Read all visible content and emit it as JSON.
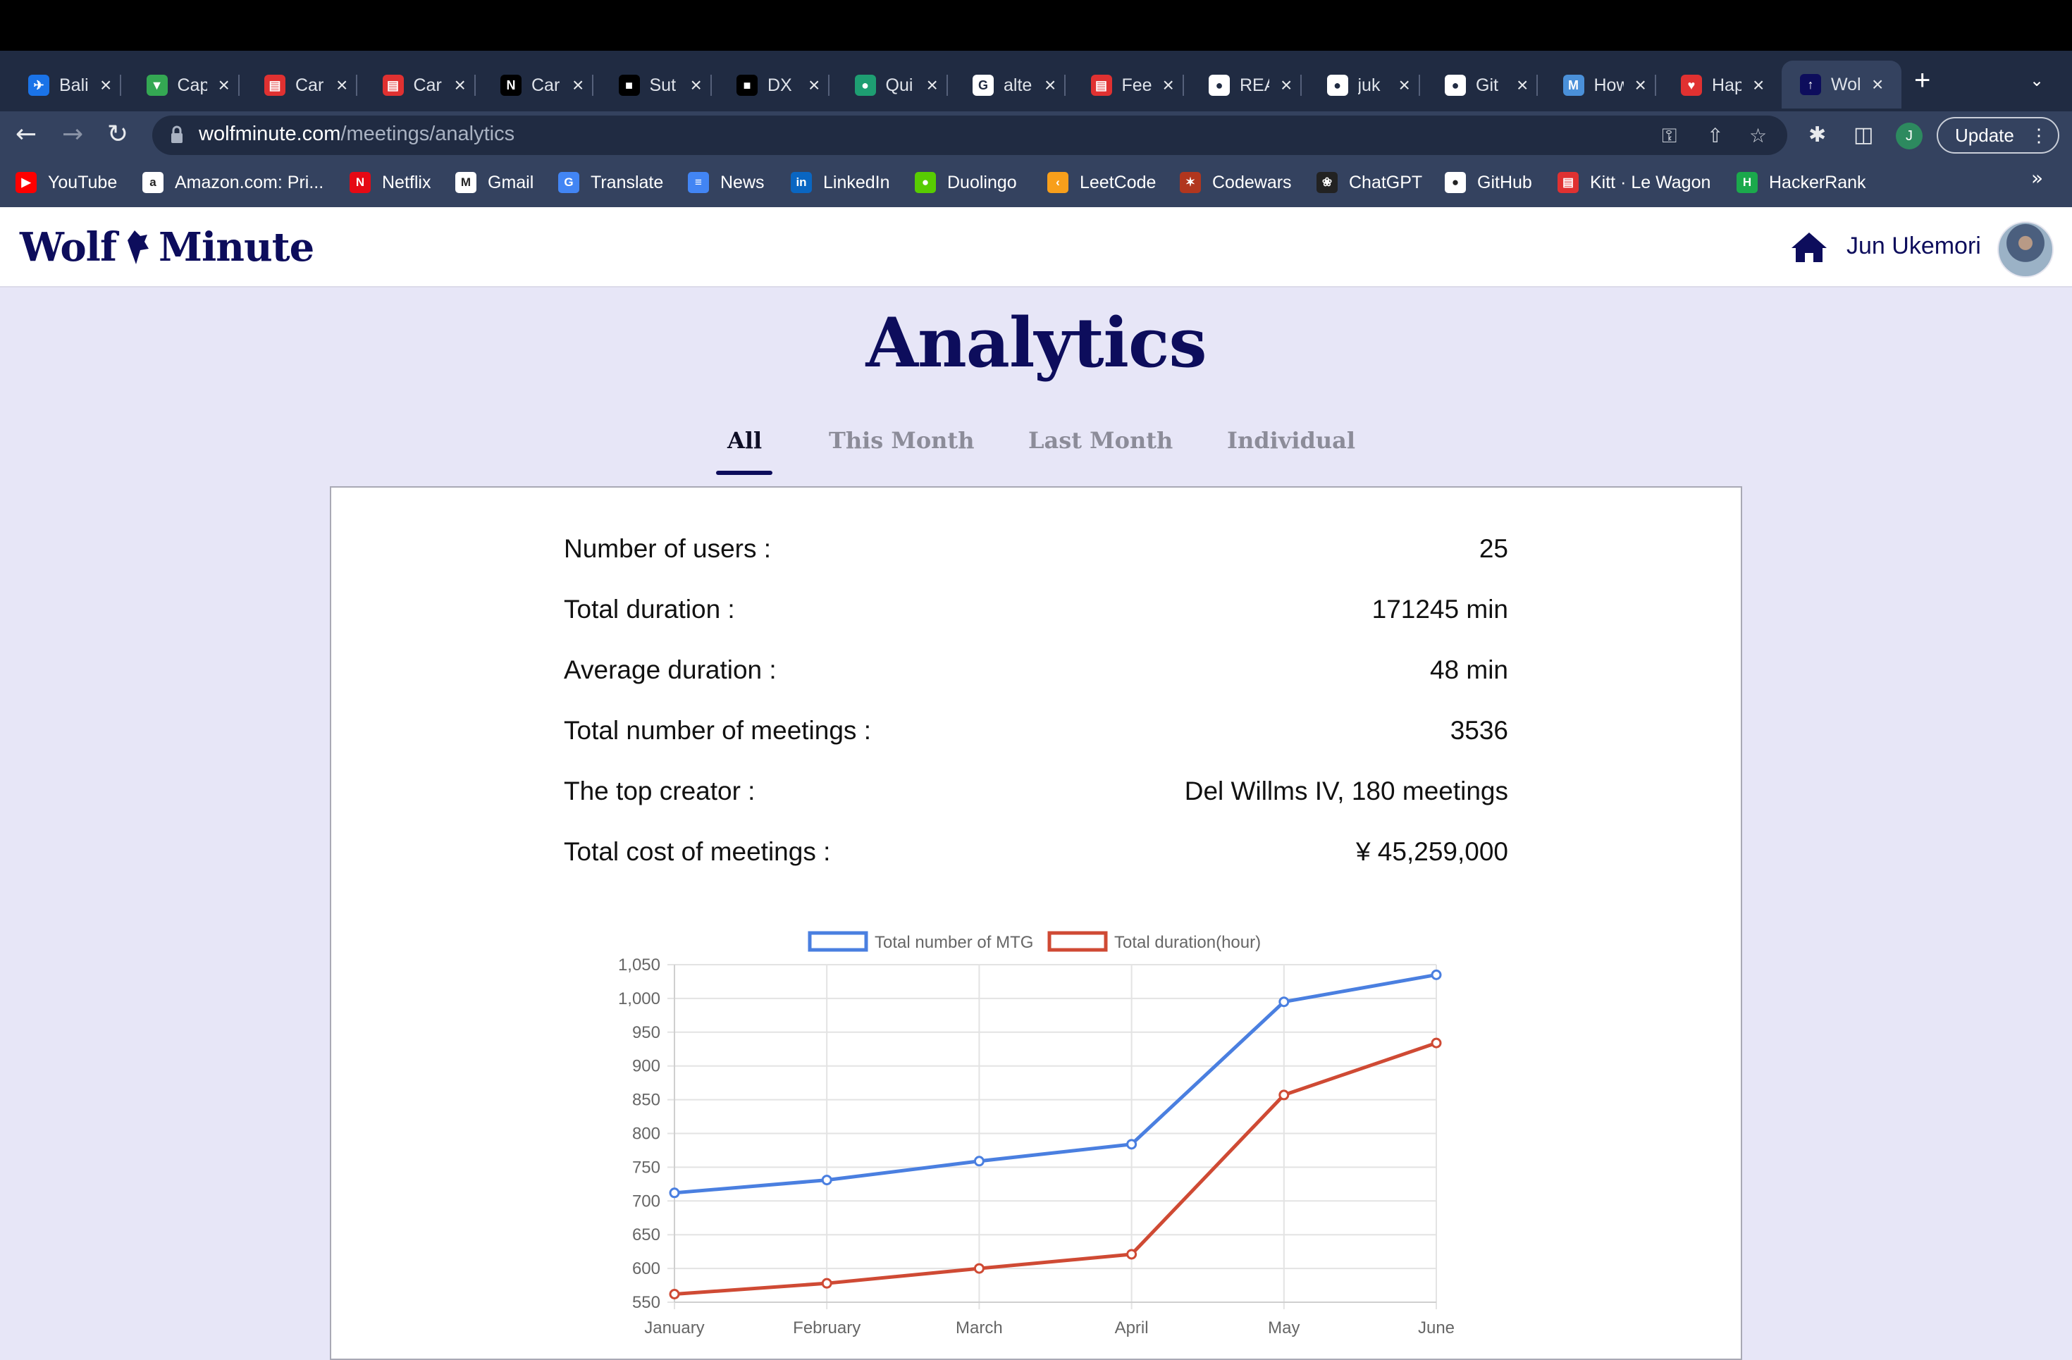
{
  "browser": {
    "tabs": [
      {
        "title": "Bali",
        "icon": "blue-plane-icon",
        "color": "#1a73e8"
      },
      {
        "title": "Cap",
        "icon": "maps-pin-icon",
        "color": "#34a853"
      },
      {
        "title": "Car",
        "icon": "lewagon-icon",
        "color": "#e03131"
      },
      {
        "title": "Car",
        "icon": "lewagon-icon",
        "color": "#e03131"
      },
      {
        "title": "Car",
        "icon": "notion-icon",
        "color": "#000000"
      },
      {
        "title": "Sut",
        "icon": "black-square-icon",
        "color": "#000000"
      },
      {
        "title": "DX",
        "icon": "black-square-icon",
        "color": "#000000"
      },
      {
        "title": "Qui",
        "icon": "green-circle-icon",
        "color": "#1e9e72"
      },
      {
        "title": "alte",
        "icon": "google-icon",
        "color": "#ffffff"
      },
      {
        "title": "Fee",
        "icon": "lewagon-icon",
        "color": "#e03131"
      },
      {
        "title": "REA",
        "icon": "github-icon",
        "color": "#ffffff"
      },
      {
        "title": "juk",
        "icon": "github-icon",
        "color": "#ffffff"
      },
      {
        "title": "Git",
        "icon": "github-icon",
        "color": "#ffffff"
      },
      {
        "title": "How",
        "icon": "m-logo-icon",
        "color": "#4a90d9"
      },
      {
        "title": "Hap",
        "icon": "heart-icon",
        "color": "#e03131"
      },
      {
        "title": "Wol",
        "icon": "wolf-icon",
        "color": "#0d0d5c"
      }
    ],
    "url_host": "wolfminute.com",
    "url_path": "/meetings/analytics",
    "profile_initial": "J",
    "update_label": "Update",
    "bookmarks": [
      {
        "label": "YouTube",
        "icon": "youtube-icon",
        "color": "#ff0000"
      },
      {
        "label": "Amazon.com: Pri...",
        "icon": "amazon-icon",
        "color": "#ffffff"
      },
      {
        "label": "Netflix",
        "icon": "netflix-icon",
        "color": "#e50914"
      },
      {
        "label": "Gmail",
        "icon": "gmail-icon",
        "color": "#ffffff"
      },
      {
        "label": "Translate",
        "icon": "translate-icon",
        "color": "#4285f4"
      },
      {
        "label": "News",
        "icon": "news-icon",
        "color": "#4285f4"
      },
      {
        "label": "LinkedIn",
        "icon": "linkedin-icon",
        "color": "#0a66c2"
      },
      {
        "label": "Duolingo",
        "icon": "duolingo-icon",
        "color": "#58cc02"
      },
      {
        "label": "LeetCode",
        "icon": "leetcode-icon",
        "color": "#f89f1b"
      },
      {
        "label": "Codewars",
        "icon": "codewars-icon",
        "color": "#b1361e"
      },
      {
        "label": "ChatGPT",
        "icon": "chatgpt-icon",
        "color": "#222222"
      },
      {
        "label": "GitHub",
        "icon": "github-icon",
        "color": "#ffffff"
      },
      {
        "label": "Kitt · Le Wagon",
        "icon": "lewagon-icon",
        "color": "#e03131"
      },
      {
        "label": "HackerRank",
        "icon": "hackerrank-icon",
        "color": "#1ba94c"
      }
    ]
  },
  "app": {
    "logo_left": "Wolf",
    "logo_right": "Minute",
    "user_name": "Jun Ukemori",
    "page_title": "Analytics",
    "tabs": [
      "All",
      "This Month",
      "Last Month",
      "Individual"
    ],
    "active_tab": "All",
    "stats": [
      {
        "label": "Number of users :",
        "value": "25"
      },
      {
        "label": "Total duration :",
        "value": "171245 min"
      },
      {
        "label": "Average duration :",
        "value": "48 min"
      },
      {
        "label": "Total number of meetings :",
        "value": "3536"
      },
      {
        "label": "The top creator :",
        "value": "Del Willms IV, 180 meetings"
      },
      {
        "label": "Total cost of meetings :",
        "value": "¥ 45,259,000"
      }
    ]
  },
  "chart_data": {
    "type": "line",
    "categories": [
      "January",
      "February",
      "March",
      "April",
      "May",
      "June"
    ],
    "series": [
      {
        "name": "Total number of MTG",
        "color": "#4a7fe0",
        "values": [
          712,
          731,
          759,
          784,
          995,
          1035
        ]
      },
      {
        "name": "Total duration(hour)",
        "color": "#cf4a34",
        "values": [
          562,
          578,
          600,
          621,
          857,
          934
        ]
      }
    ],
    "ylim": [
      550,
      1050
    ],
    "yticks": [
      "550",
      "600",
      "650",
      "700",
      "750",
      "800",
      "850",
      "900",
      "950",
      "1,000",
      "1,050"
    ],
    "legend": "top",
    "grid": true
  }
}
